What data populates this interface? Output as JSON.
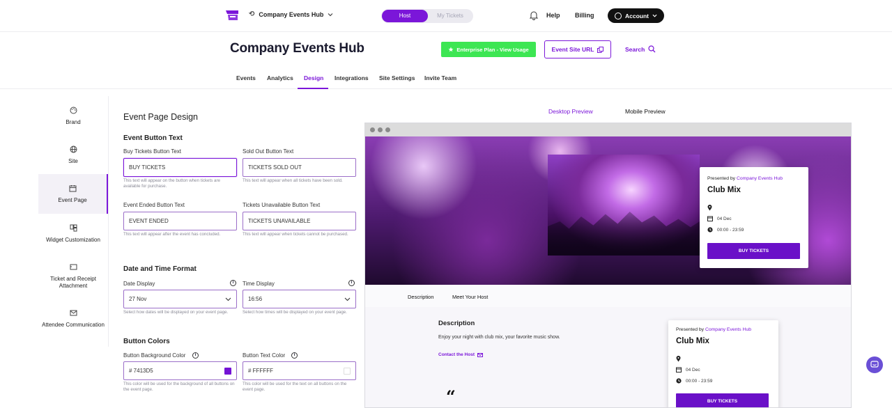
{
  "header": {
    "hub_name": "Company Events Hub",
    "toggle_host": "Host",
    "toggle_tickets": "My Tickets",
    "help": "Help",
    "billing": "Billing",
    "account": "Account"
  },
  "page": {
    "title": "Company Events Hub",
    "plan_button": "Enterprise Plan - View Usage",
    "url_button": "Event Site URL",
    "search": "Search"
  },
  "tabs": [
    "Events",
    "Analytics",
    "Design",
    "Integrations",
    "Site Settings",
    "Invite Team"
  ],
  "sidebar": [
    {
      "label": "Brand",
      "icon": "palette-icon"
    },
    {
      "label": "Site",
      "icon": "globe-icon"
    },
    {
      "label": "Event Page",
      "icon": "calendar-icon"
    },
    {
      "label": "Widget Customization",
      "icon": "widget-icon"
    },
    {
      "label": "Ticket and Receipt Attachment",
      "icon": "ticket-icon"
    },
    {
      "label": "Attendee Communication",
      "icon": "mail-icon"
    }
  ],
  "form": {
    "heading": "Event Page Design",
    "button_section": "Event Button Text",
    "buy_label": "Buy Tickets Button Text",
    "buy_value": "BUY TICKETS",
    "buy_help": "This text will appear on the button when tickets are available for purchase.",
    "sold_label": "Sold Out Button Text",
    "sold_value": "TICKETS SOLD OUT",
    "sold_help": "This text will appear when all tickets have been sold.",
    "ended_label": "Event Ended Button Text",
    "ended_value": "EVENT ENDED",
    "ended_help": "This text will appear after the event has concluded.",
    "unavail_label": "Tickets Unavailable Button Text",
    "unavail_value": "TICKETS UNAVAILABLE",
    "unavail_help": "This text will appear when tickets cannot be purchased.",
    "datetime_section": "Date and Time Format",
    "date_label": "Date Display",
    "date_value": "27 Nov",
    "date_help": "Select how dates will be displayed on your event page.",
    "time_label": "Time Display",
    "time_value": "16:56",
    "time_help": "Select how times will be displayed on your event page.",
    "colors_section": "Button Colors",
    "bg_label": "Button Background Color",
    "bg_value": "#  7413D5",
    "bg_help": "This color will be used for the background of all buttons on the event page.",
    "text_label": "Button Text Color",
    "text_value": "#  FFFFFF",
    "text_help": "This color will be used for the text on all buttons on the event page."
  },
  "colors": {
    "accent": "#7b16d9",
    "button_bg": "#7413D5",
    "button_text": "#FFFFFF",
    "plan": "#3de653"
  },
  "preview": {
    "desktop": "Desktop Preview",
    "mobile": "Mobile Preview",
    "presented_by": "Presented by",
    "host": "Company Events Hub",
    "event_title": "Club Mix",
    "date": "04 Dec",
    "time": "00:00 - 23:59",
    "buy": "BUY TICKETS",
    "tab_description": "Description",
    "tab_host": "Meet Your Host",
    "desc_heading": "Description",
    "desc_text": "Enjoy your night with club mix, your favorite music show.",
    "contact": "Contact the Host",
    "quote": "“"
  }
}
